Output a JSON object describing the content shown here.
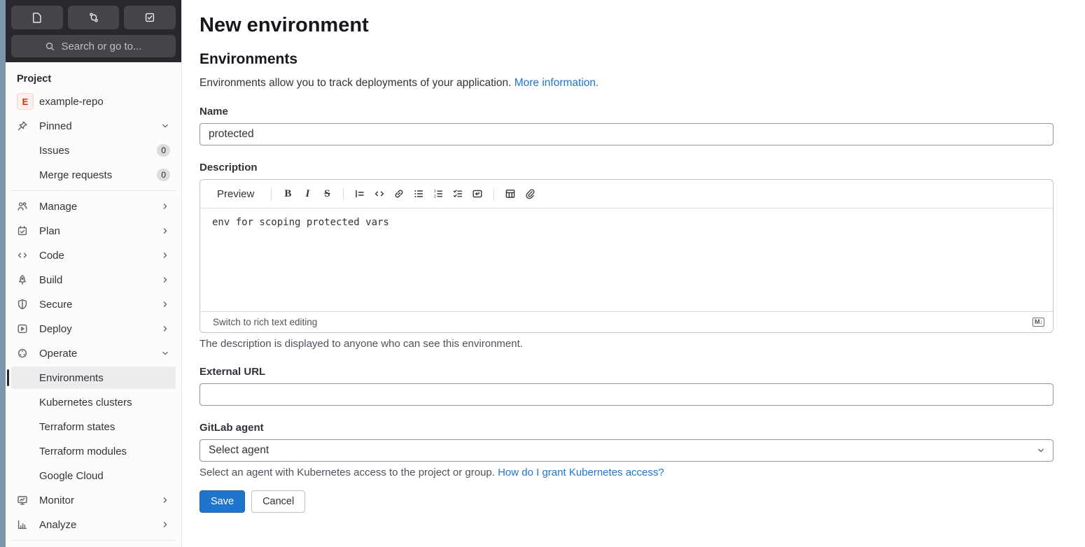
{
  "topbar": {
    "search_placeholder": "Search or go to...",
    "icons": [
      "issues-icon",
      "merge-request-icon",
      "todo-icon"
    ]
  },
  "sidebar": {
    "section_label": "Project",
    "project": {
      "avatar_letter": "E",
      "name": "example-repo"
    },
    "pinned_label": "Pinned",
    "issues": {
      "label": "Issues",
      "count": "0"
    },
    "merge_requests": {
      "label": "Merge requests",
      "count": "0"
    },
    "items": {
      "manage": "Manage",
      "plan": "Plan",
      "code": "Code",
      "build": "Build",
      "secure": "Secure",
      "deploy": "Deploy",
      "operate": "Operate",
      "environments": "Environments",
      "kubernetes": "Kubernetes clusters",
      "tf_states": "Terraform states",
      "tf_modules": "Terraform modules",
      "google_cloud": "Google Cloud",
      "monitor": "Monitor",
      "analyze": "Analyze"
    },
    "active_item": "Environments"
  },
  "main": {
    "page_title": "New environment",
    "section_title": "Environments",
    "intro_text": "Environments allow you to track deployments of your application. ",
    "intro_link": "More information.",
    "name": {
      "label": "Name",
      "value": "protected"
    },
    "description": {
      "label": "Description",
      "preview_label": "Preview",
      "content": "env for scoping protected vars",
      "switch_label": "Switch to rich text editing",
      "markdown_badge": "M↓",
      "toolbar_icons": [
        "bold-icon",
        "italic-icon",
        "strikethrough-icon",
        "quote-icon",
        "code-icon",
        "link-icon",
        "bulleted-list-icon",
        "numbered-list-icon",
        "task-list-icon",
        "collapsible-section-icon",
        "table-icon",
        "attach-file-icon"
      ],
      "help": "The description is displayed to anyone who can see this environment."
    },
    "external_url": {
      "label": "External URL",
      "value": ""
    },
    "agent": {
      "label": "GitLab agent",
      "value": "Select agent",
      "help": "Select an agent with Kubernetes access to the project or group. ",
      "help_link": "How do I grant Kubernetes access?"
    },
    "save_label": "Save",
    "cancel_label": "Cancel"
  },
  "colors": {
    "accent_blue": "#1f75cb",
    "link_blue": "#1f75cb",
    "topbar_bg": "#28272d",
    "topbar_button_bg": "#454449",
    "sidebar_bg": "#fcfcfd",
    "active_item_bg": "#ececef",
    "avatar_bg": "#fdf1ef",
    "avatar_text": "#dd2b0e",
    "left_strip": "#7d95ab"
  }
}
